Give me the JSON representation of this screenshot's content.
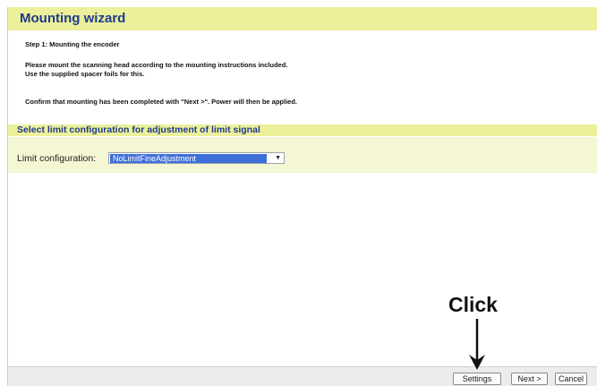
{
  "window": {
    "title": "Mounting wizard"
  },
  "step": {
    "heading": "Step 1: Mounting the encoder"
  },
  "instructions": [
    "Please mount the scanning head according to the mounting instructions included.",
    "Use the supplied spacer foils for this.",
    "Confirm that mounting has been completed with \"Next >\". Power will then be applied."
  ],
  "limit_section": {
    "heading": "Select limit configuration for adjustment of limit signal",
    "field_label": "Limit configuration:",
    "selected_value": "NoLimitFineAdjustment"
  },
  "buttons": {
    "settings": "Settings",
    "next": "Next  >",
    "cancel": "Cancel"
  },
  "annotation": {
    "text": "Click"
  },
  "colors": {
    "header_bg": "#ecf09a",
    "header_text": "#1e3a8f",
    "selection": "#3e6fd8"
  }
}
